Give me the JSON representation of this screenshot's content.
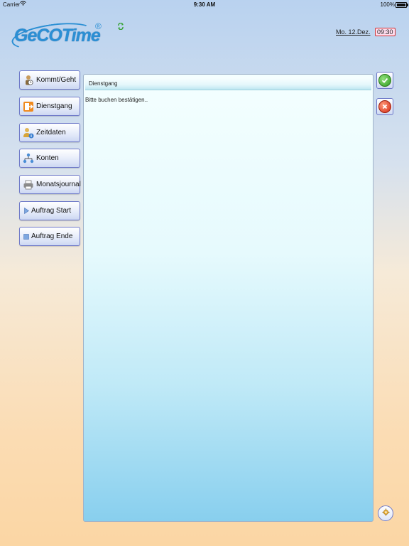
{
  "status_bar": {
    "carrier": "Carrier",
    "time": "9:30 AM",
    "battery": "100%",
    "wifi_icon": "wifi-icon",
    "battery_icon": "battery-icon"
  },
  "header": {
    "logo_text": "GeCOTime",
    "logo_reg": "®",
    "sync_icon": "sync-icon",
    "date": "Mo. 12.Dez.",
    "time": "09:30"
  },
  "nav": {
    "items": [
      {
        "label": "Kommt/Geht",
        "icon": "person-clock-icon"
      },
      {
        "label": "Dienstgang",
        "icon": "exit-door-icon"
      },
      {
        "label": "Zeitdaten",
        "icon": "user-info-icon"
      },
      {
        "label": "Konten",
        "icon": "accounts-tree-icon"
      },
      {
        "label": "Monatsjournal",
        "icon": "printer-icon"
      },
      {
        "label": "Auftrag Start",
        "icon": "play-icon"
      },
      {
        "label": "Auftrag Ende",
        "icon": "stop-icon"
      }
    ]
  },
  "panel": {
    "title": "Dienstgang",
    "message": "Bitte buchen bestätigen.."
  },
  "actions": {
    "confirm_icon": "checkmark-icon",
    "cancel_icon": "cancel-icon",
    "settings_icon": "settings-icon"
  },
  "colors": {
    "logo": "#2b8fd4",
    "confirm": "#2f9a1f",
    "cancel": "#d32a14",
    "button_border": "#6d78c8"
  }
}
